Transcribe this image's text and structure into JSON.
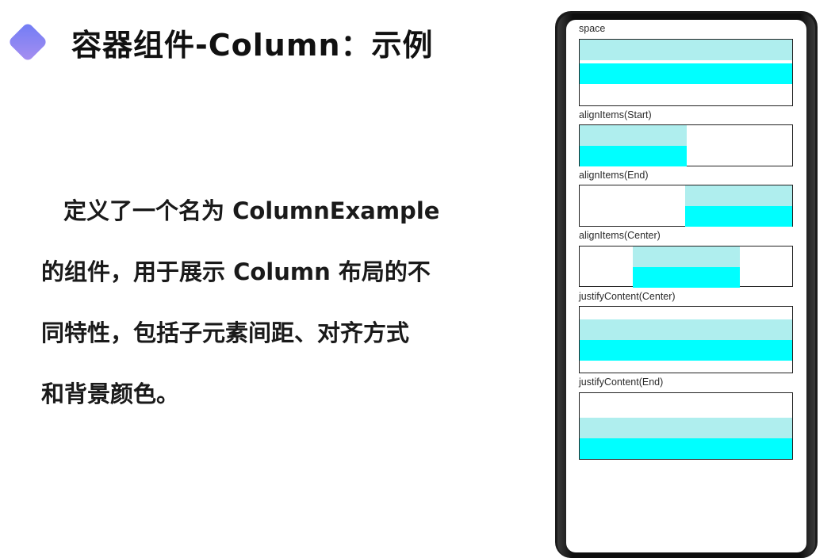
{
  "slide": {
    "title": "容器组件-Column：示例",
    "description_lines": [
      "定义了一个名为 ColumnExample",
      "的组件，用于展示 Column 布局的不",
      "同特性，包括子元素间距、对齐方式",
      "和背景颜色。"
    ]
  },
  "preview": {
    "sections": [
      {
        "label": "space"
      },
      {
        "label": "alignItems(Start)"
      },
      {
        "label": "alignItems(End)"
      },
      {
        "label": "alignItems(Center)"
      },
      {
        "label": "justifyContent(Center)"
      },
      {
        "label": "justifyContent(End)"
      }
    ],
    "colors": {
      "item_light": "#afeeee",
      "item_cyan": "#00ffff",
      "accent_gradient": [
        "#6f7cf5",
        "#a88ff0"
      ]
    }
  }
}
